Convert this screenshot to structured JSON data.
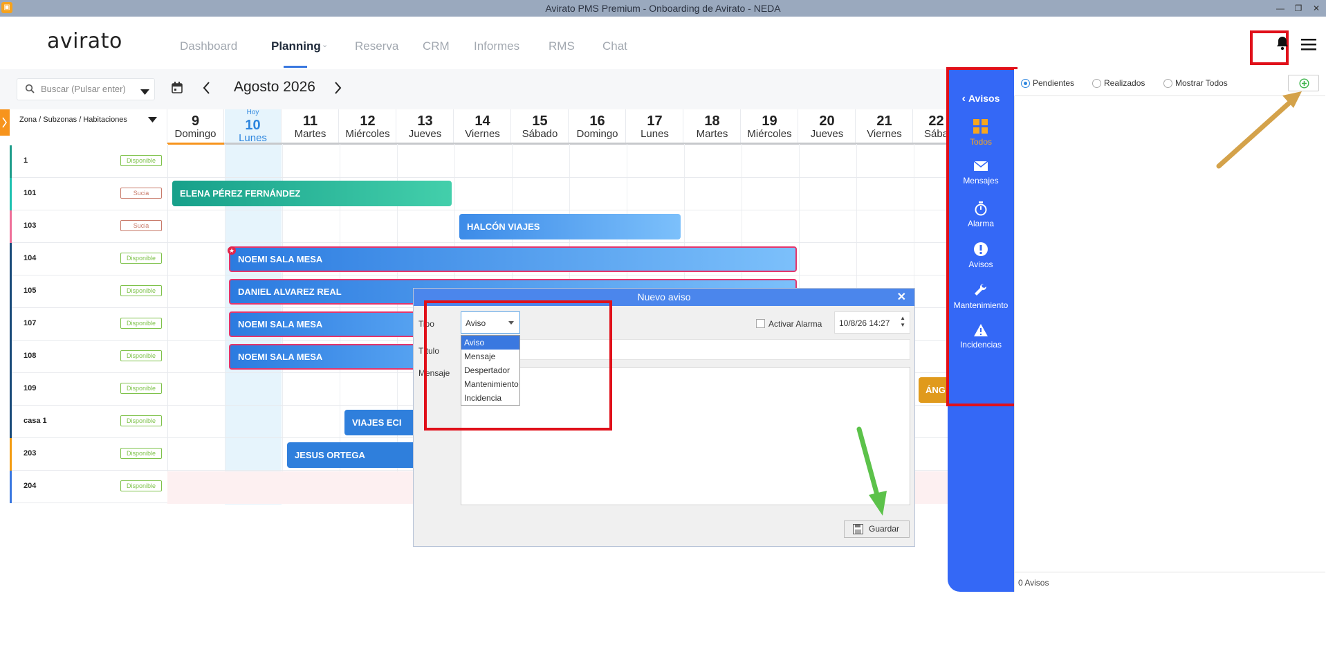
{
  "window": {
    "title": "Avirato PMS Premium - Onboarding de Avirato - NEDA",
    "app_icon": "avirato-app-icon"
  },
  "brand": {
    "logo_text": "avirato"
  },
  "nav": {
    "items": [
      {
        "label": "Dashboard"
      },
      {
        "label": "Planning"
      },
      {
        "label": "Reserva"
      },
      {
        "label": "CRM"
      },
      {
        "label": "Informes"
      },
      {
        "label": "RMS"
      },
      {
        "label": "Chat"
      }
    ],
    "active": "Planning"
  },
  "toolbar": {
    "search_placeholder": "Buscar (Pulsar enter)",
    "month_label": "Agosto 2026"
  },
  "grid": {
    "zone_header": "Zona / Subzonas / Habitaciones",
    "today_label": "Hoy",
    "days": [
      {
        "n": "9",
        "d": "Domingo"
      },
      {
        "n": "10",
        "d": "Lunes"
      },
      {
        "n": "11",
        "d": "Martes"
      },
      {
        "n": "12",
        "d": "Miércoles"
      },
      {
        "n": "13",
        "d": "Jueves"
      },
      {
        "n": "14",
        "d": "Viernes"
      },
      {
        "n": "15",
        "d": "Sábado"
      },
      {
        "n": "16",
        "d": "Domingo"
      },
      {
        "n": "17",
        "d": "Lunes"
      },
      {
        "n": "18",
        "d": "Martes"
      },
      {
        "n": "19",
        "d": "Miércoles"
      },
      {
        "n": "20",
        "d": "Jueves"
      },
      {
        "n": "21",
        "d": "Viernes"
      },
      {
        "n": "22",
        "d": "Sába"
      }
    ],
    "rooms": [
      {
        "name": "1",
        "status": "Disponible"
      },
      {
        "name": "101",
        "status": "Sucia"
      },
      {
        "name": "103",
        "status": "Sucia"
      },
      {
        "name": "104",
        "status": "Disponible"
      },
      {
        "name": "105",
        "status": "Disponible"
      },
      {
        "name": "107",
        "status": "Disponible"
      },
      {
        "name": "108",
        "status": "Disponible"
      },
      {
        "name": "109",
        "status": "Disponible"
      },
      {
        "name": "casa 1",
        "status": "Disponible"
      },
      {
        "name": "203",
        "status": "Disponible"
      },
      {
        "name": "204",
        "status": "Disponible"
      }
    ],
    "bookings": [
      {
        "guest": "ELENA PÉREZ FERNÁNDEZ"
      },
      {
        "guest": "HALCÓN VIAJES"
      },
      {
        "guest": "NOEMI SALA MESA"
      },
      {
        "guest": "DANIEL ALVAREZ REAL"
      },
      {
        "guest": "NOEMI SALA MESA"
      },
      {
        "guest": "NOEMI SALA MESA"
      },
      {
        "guest": "ÁNG"
      },
      {
        "guest": "VIAJES ECI"
      },
      {
        "guest": "JESUS ORTEGA"
      }
    ]
  },
  "avisos_nav": {
    "back_label": "Avisos",
    "items": [
      {
        "label": "Todos",
        "icon": "grid-icon"
      },
      {
        "label": "Mensajes",
        "icon": "envelope-icon"
      },
      {
        "label": "Alarma",
        "icon": "stopwatch-icon"
      },
      {
        "label": "Avisos",
        "icon": "exclamation-icon"
      },
      {
        "label": "Mantenimiento",
        "icon": "wrench-icon"
      },
      {
        "label": "Incidencias",
        "icon": "warning-icon"
      }
    ]
  },
  "filters": {
    "pendientes": "Pendientes",
    "realizados": "Realizados",
    "mostrar_todos": "Mostrar Todos",
    "selected": "Pendientes"
  },
  "panel_footer": {
    "count": "0 Avisos"
  },
  "dialog": {
    "title": "Nuevo aviso",
    "tipo_label": "Tipo",
    "tipo_value": "Aviso",
    "titulo_label": "Título",
    "mensaje_label": "Mensaje",
    "alarm_label": "Activar Alarma",
    "alarm_datetime": "10/8/26 14:27",
    "save_label": "Guardar",
    "options": [
      "Aviso",
      "Mensaje",
      "Despertador",
      "Mantenimiento",
      "Incidencia"
    ]
  },
  "colors": {
    "accent": "#3468f6",
    "annotation_red": "#e0101a",
    "arrow_gold": "#d4a24a",
    "arrow_green": "#5cc24a",
    "selected_orange": "#f7a51e"
  }
}
